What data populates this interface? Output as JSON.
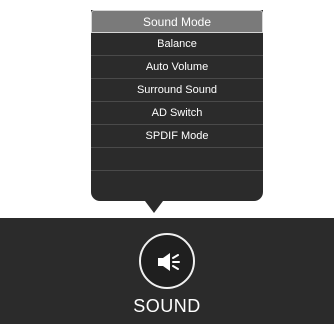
{
  "menu": {
    "title": "Sound Mode",
    "items": [
      "Balance",
      "Auto Volume",
      "Surround Sound",
      "AD Switch",
      "SPDIF Mode"
    ]
  },
  "bottom": {
    "icon": "speaker-icon",
    "label": "SOUND"
  },
  "colors": {
    "panel": "#2b2b2b",
    "selected": "#7a7a7a",
    "text": "#ffffff"
  }
}
